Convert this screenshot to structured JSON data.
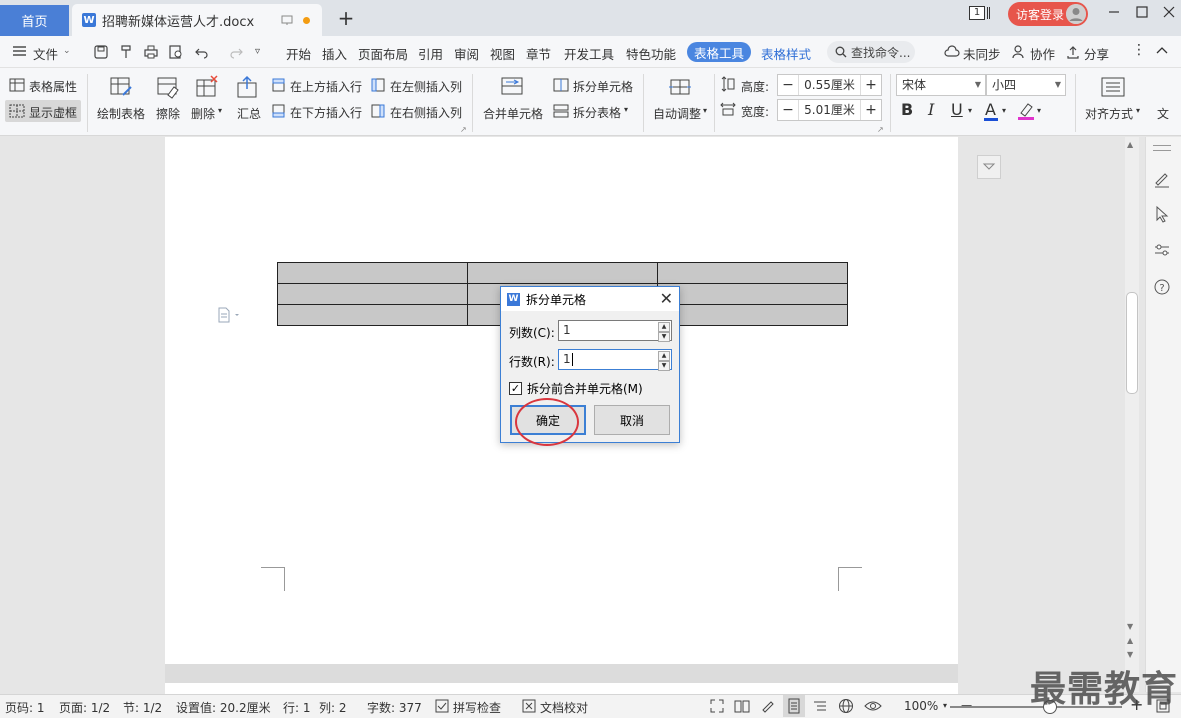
{
  "titlebar": {
    "home_tab": "首页",
    "doc_tab": "招聘新媒体运营人才.docx",
    "login_button": "访客登录",
    "page_indicator": "1"
  },
  "menubar": {
    "file": "文件",
    "tabs": [
      "开始",
      "插入",
      "页面布局",
      "引用",
      "审阅",
      "视图",
      "章节",
      "开发工具",
      "特色功能"
    ],
    "active_tab": "表格工具",
    "style_tab": "表格样式",
    "search": "查找命令...",
    "unsynced": "未同步",
    "collaborate": "协作",
    "share": "分享"
  },
  "ribbon": {
    "table_props": "表格属性",
    "show_gridlines": "显示虚框",
    "draw_table": "绘制表格",
    "erase": "擦除",
    "delete": "删除",
    "summary": "汇总",
    "insert_above": "在上方插入行",
    "insert_below": "在下方插入行",
    "insert_left": "在左侧插入列",
    "insert_right": "在右侧插入列",
    "merge_cells": "合并单元格",
    "split_cells": "拆分单元格",
    "split_table": "拆分表格",
    "auto_fit": "自动调整",
    "height_label": "高度:",
    "height_value": "0.55厘米",
    "width_label": "宽度:",
    "width_value": "5.01厘米",
    "font_name": "宋体",
    "font_size": "小四",
    "bold": "B",
    "italic": "I",
    "underline": "U",
    "font_color": "A",
    "align": "对齐方式",
    "text_dir": "文"
  },
  "dialog": {
    "title": "拆分单元格",
    "columns_label": "列数(C):",
    "columns_value": "1",
    "rows_label": "行数(R):",
    "rows_value": "1",
    "merge_checkbox": "拆分前合并单元格(M)",
    "merge_checked": true,
    "ok": "确定",
    "cancel": "取消"
  },
  "statusbar": {
    "page_num": "页码: 1",
    "pages": "页面: 1/2",
    "section": "节: 1/2",
    "setting": "设置值: 20.2厘米",
    "row": "行: 1",
    "col": "列: 2",
    "word_count": "字数: 377",
    "spell_check": "拼写检查",
    "doc_proof": "文档校对",
    "zoom": "100%",
    "zoom_level": 1.0
  },
  "watermark": "最需教育",
  "colors": {
    "accent": "#4a86e0",
    "login": "#e7554b",
    "highlight_circle": "#d9363e",
    "table_fill": "#c8c8c8"
  }
}
